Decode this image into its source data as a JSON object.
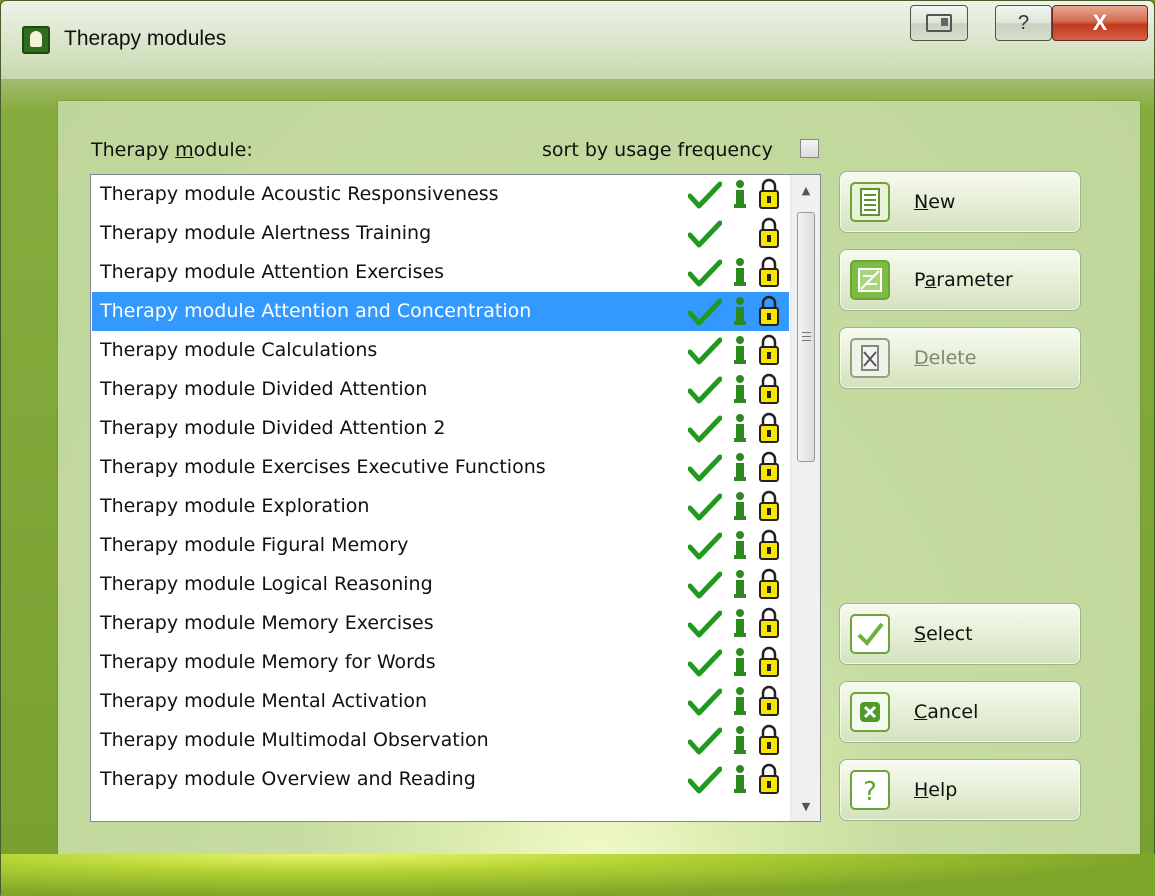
{
  "window": {
    "title": "Therapy modules",
    "help_glyph": "?",
    "close_glyph": "X",
    "minimize_icon": "restore-window-icon"
  },
  "list": {
    "caption_pre": "Therapy ",
    "caption_accel": "m",
    "caption_post": "odule:",
    "sort_label": "sort by usage frequency",
    "sort_checked": false,
    "selected_index": 3,
    "items": [
      {
        "label": "Therapy module Acoustic Responsiveness",
        "check": true,
        "info": true,
        "lock": true
      },
      {
        "label": "Therapy module Alertness Training",
        "check": true,
        "info": false,
        "lock": true
      },
      {
        "label": "Therapy module Attention Exercises",
        "check": true,
        "info": true,
        "lock": true
      },
      {
        "label": "Therapy module Attention and Concentration",
        "check": true,
        "info": true,
        "lock": true
      },
      {
        "label": "Therapy module Calculations",
        "check": true,
        "info": true,
        "lock": true
      },
      {
        "label": "Therapy module Divided Attention",
        "check": true,
        "info": true,
        "lock": true
      },
      {
        "label": "Therapy module Divided Attention 2",
        "check": true,
        "info": true,
        "lock": true
      },
      {
        "label": "Therapy module Exercises Executive Functions",
        "check": true,
        "info": true,
        "lock": true
      },
      {
        "label": "Therapy module Exploration",
        "check": true,
        "info": true,
        "lock": true
      },
      {
        "label": "Therapy module Figural Memory",
        "check": true,
        "info": true,
        "lock": true
      },
      {
        "label": "Therapy module Logical Reasoning",
        "check": true,
        "info": true,
        "lock": true
      },
      {
        "label": "Therapy module Memory Exercises",
        "check": true,
        "info": true,
        "lock": true
      },
      {
        "label": "Therapy module Memory for Words",
        "check": true,
        "info": true,
        "lock": true
      },
      {
        "label": "Therapy module Mental Activation",
        "check": true,
        "info": true,
        "lock": true
      },
      {
        "label": "Therapy module Multimodal Observation",
        "check": true,
        "info": true,
        "lock": true
      },
      {
        "label": "Therapy module Overview and Reading",
        "check": true,
        "info": true,
        "lock": true
      }
    ]
  },
  "buttons": {
    "new": {
      "accel": "N",
      "rest": "ew",
      "icon": "document-list-icon",
      "enabled": true
    },
    "parameter": {
      "pre": "P",
      "accel": "a",
      "rest": "rameter",
      "icon": "edit-sheet-icon",
      "enabled": true
    },
    "delete": {
      "accel": "D",
      "rest": "elete",
      "icon": "delete-document-icon",
      "enabled": false
    },
    "select": {
      "accel": "S",
      "rest": "elect",
      "icon": "checkmark-icon",
      "enabled": true
    },
    "cancel": {
      "accel": "C",
      "rest": "ancel",
      "icon": "cancel-x-icon",
      "enabled": true
    },
    "help": {
      "accel": "H",
      "rest": "elp",
      "icon": "question-icon",
      "enabled": true
    }
  },
  "colors": {
    "selection": "#3399ff",
    "check_green": "#1f9a1f",
    "lock_yellow": "#f6e600",
    "info_green": "#2d8a1e"
  }
}
